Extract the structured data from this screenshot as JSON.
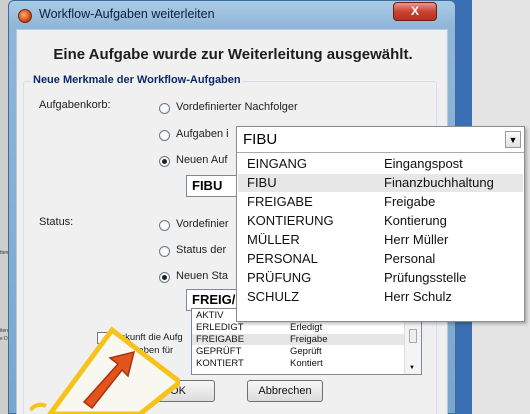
{
  "window": {
    "title": "Workflow-Aufgaben weiterleiten",
    "close_glyph": "X"
  },
  "heading": "Eine Aufgabe wurde zur Weiterleitung ausgewählt.",
  "group_title": "Neue Merkmale der Workflow-Aufgaben",
  "basket": {
    "label": "Aufgabenkorb:",
    "options": [
      "Vordefinierter Nachfolger",
      "Aufgaben i",
      "Neuen Auf"
    ],
    "selected_index": 2,
    "combo_value": "FIBU"
  },
  "status": {
    "label": "Status:",
    "options": [
      "Vordefinier",
      "Status der",
      "Neuen Sta"
    ],
    "selected_index": 2,
    "combo_value": "FREIG/"
  },
  "bottom": {
    "checkbox_text_1": "Zukunft die Aufg",
    "checkbox_text_2": "e Angaben für"
  },
  "buttons": {
    "ok": "OK",
    "cancel": "Abbrechen"
  },
  "basket_dropdown": {
    "selected_value": "FIBU",
    "arrow_glyph": "▼",
    "items": [
      {
        "code": "EINGANG",
        "name": "Eingangspost"
      },
      {
        "code": "FIBU",
        "name": "Finanzbuchhaltung"
      },
      {
        "code": "FREIGABE",
        "name": "Freigabe"
      },
      {
        "code": "KONTIERUNG",
        "name": "Kontierung"
      },
      {
        "code": "MÜLLER",
        "name": "Herr Müller"
      },
      {
        "code": "PERSONAL",
        "name": "Personal"
      },
      {
        "code": "PRÜFUNG",
        "name": "Prüfungsstelle"
      },
      {
        "code": "SCHULZ",
        "name": "Herr Schulz"
      }
    ],
    "highlighted_index": 1
  },
  "status_list": {
    "items": [
      {
        "code": "AKTIV",
        "name": ""
      },
      {
        "code": "ERLEDIGT",
        "name": "Erledigt"
      },
      {
        "code": "FREIGABE",
        "name": "Freigabe"
      },
      {
        "code": "GEPRÜFT",
        "name": "Geprüft"
      },
      {
        "code": "KONTIERT",
        "name": "Kontiert"
      }
    ],
    "highlighted_index": 2
  },
  "background_fragments": [
    "tten",
    "itere",
    "e D3"
  ],
  "colors": {
    "accent_orange": "#e2541c",
    "badge_yellow": "#f6c21c",
    "title_blue": "#0c2a66"
  },
  "icons": [
    "app-icon",
    "close-icon",
    "dropdown-arrow-icon",
    "forward-arrow-icon"
  ]
}
